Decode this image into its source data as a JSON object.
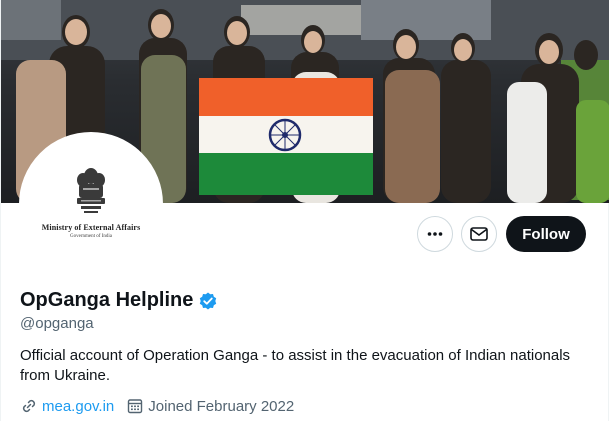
{
  "profile": {
    "name": "OpGanga Helpline",
    "handle": "@opganga",
    "bio": "Official account of Operation Ganga - to assist in the evacuation of Indian nationals from Ukraine.",
    "website": "mea.gov.in",
    "joined": "Joined February 2022"
  },
  "avatar": {
    "org_name": "Ministry of External Affairs",
    "org_sub": "Government of India"
  },
  "actions": {
    "follow_label": "Follow"
  },
  "icons": {
    "more": "more-icon",
    "message": "mail-icon",
    "verified": "verified-badge-icon",
    "link": "link-icon",
    "calendar": "calendar-icon"
  },
  "colors": {
    "accent": "#1d9bf0",
    "text_primary": "#0f1419",
    "text_secondary": "#536471",
    "follow_bg": "#0f1419",
    "flag_saffron": "#f0602a",
    "flag_green": "#1d8a3a",
    "flag_chakra": "#1f2a6b"
  }
}
